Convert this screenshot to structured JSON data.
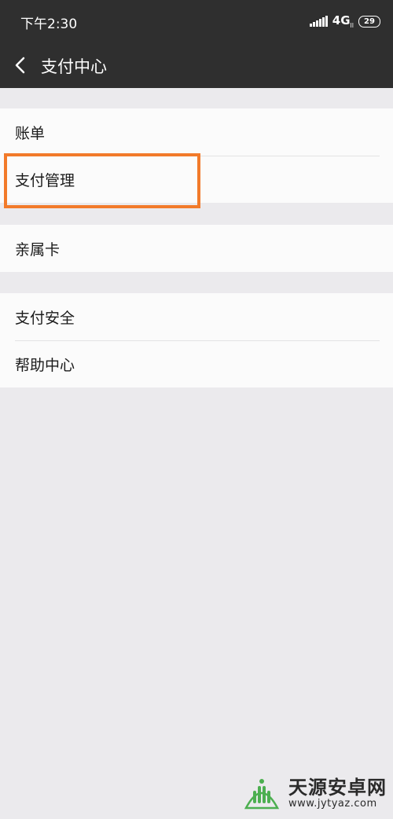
{
  "status_bar": {
    "time": "下午2:30",
    "network": "4G",
    "network_sub": "ll",
    "battery": "29"
  },
  "header": {
    "back_icon": "chevron-left-icon",
    "title": "支付中心"
  },
  "groups": [
    {
      "items": [
        {
          "label": "账单"
        },
        {
          "label": "支付管理"
        }
      ]
    },
    {
      "items": [
        {
          "label": "亲属卡"
        }
      ]
    },
    {
      "items": [
        {
          "label": "支付安全"
        },
        {
          "label": "帮助中心"
        }
      ]
    }
  ],
  "highlight_target": "支付管理",
  "highlight_color": "#f27a2a",
  "watermark": {
    "title": "天源安卓网",
    "url": "www.jytyaz.com",
    "logo_color": "#4caf50"
  }
}
